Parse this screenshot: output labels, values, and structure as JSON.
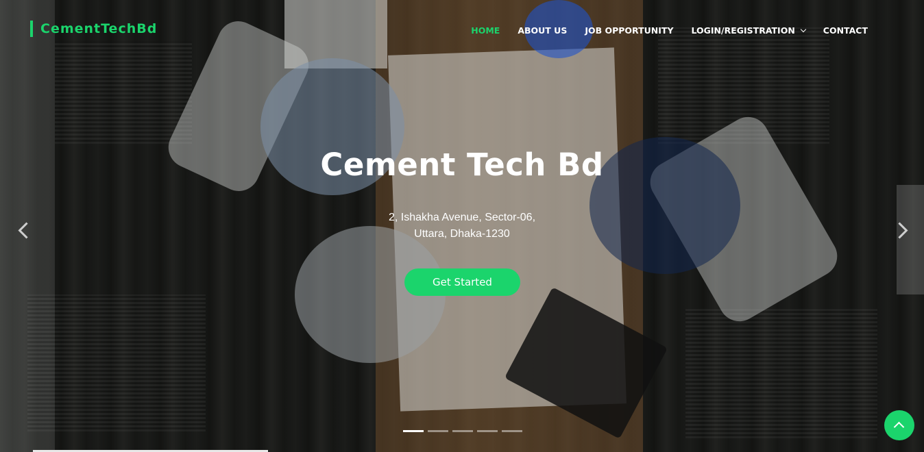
{
  "header": {
    "logo_text": "CementTechBd",
    "nav": [
      {
        "label": "HOME",
        "active": true
      },
      {
        "label": "ABOUT US",
        "active": false
      },
      {
        "label": "JOB OPPORTUNITY",
        "active": false
      },
      {
        "label": "LOGIN/REGISTRATION",
        "active": false,
        "has_dropdown": true
      },
      {
        "label": "CONTACT",
        "active": false
      }
    ]
  },
  "hero": {
    "title": "Cement Tech Bd",
    "address_line1": "2, Ishakha Avenue, Sector-06,",
    "address_line2": "Uttara, Dhaka-1230",
    "cta_label": "Get Started"
  },
  "carousel": {
    "slide_count": 5,
    "active_index": 0
  },
  "colors": {
    "accent": "#1bd46c",
    "text": "#ffffff"
  },
  "icons": {
    "prev": "chevron-left-icon",
    "next": "chevron-right-icon",
    "dropdown": "chevron-down-icon",
    "back_to_top": "arrow-up-icon"
  }
}
